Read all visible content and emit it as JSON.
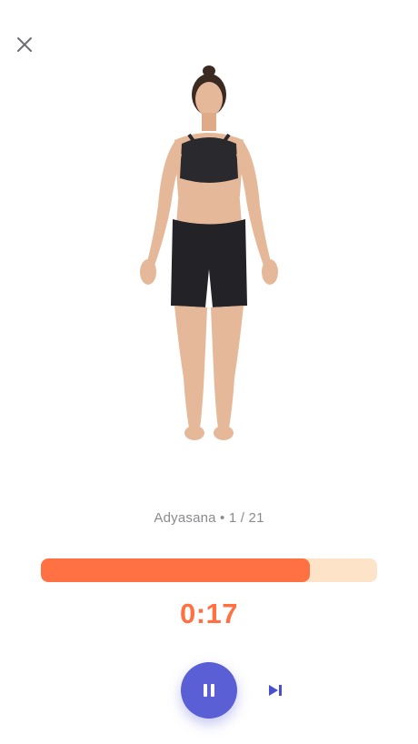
{
  "header": {
    "close_icon": "close-icon"
  },
  "pose": {
    "label": "Adyasana • 1 / 21",
    "image": "woman-standing-pose"
  },
  "progress": {
    "fraction": 0.8,
    "fill_color": "#ff7043",
    "track_color": "#fde4c9"
  },
  "timer": {
    "value": "0:17",
    "color": "#ff7043"
  },
  "controls": {
    "pause_icon": "pause-icon",
    "skip_icon": "skip-next-icon",
    "accent_color": "#5a5fd6"
  }
}
